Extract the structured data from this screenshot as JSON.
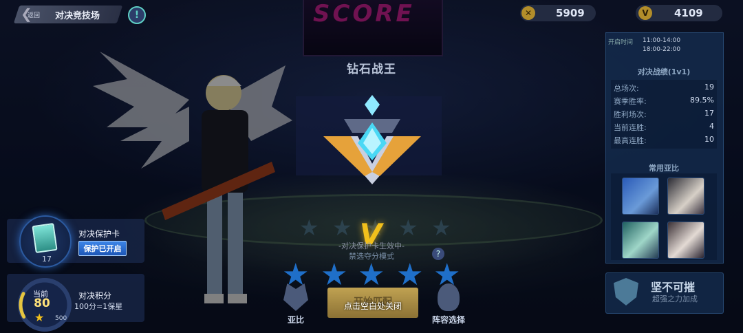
{
  "header": {
    "back_label": "返回",
    "title": "对决竞技场",
    "info": "!",
    "currency_gold": "5909",
    "currency_v": "4109"
  },
  "arena": {
    "scoreboard": "SCORE"
  },
  "rank": {
    "name": "钻石战王",
    "tier_letter": "V",
    "protect_status": "-对决保护卡生效中-",
    "mode": "禁选夺分模式",
    "help": "?",
    "stars_filled": 5,
    "stars_total": 5
  },
  "protect_card": {
    "count": "17",
    "title": "对决保护卡",
    "button": "保护已开启"
  },
  "points": {
    "now_label": "当前",
    "value": "80",
    "max": "500",
    "progress": 0.16,
    "title": "对决积分",
    "rule": "100分=1保星"
  },
  "bottom": {
    "yabi": "亚比",
    "match": "开始匹配",
    "close_hint": "点击空白处关闭",
    "team": "阵容选择"
  },
  "panel": {
    "open_label": "开启时间",
    "open_times": [
      "11:00-14:00",
      "18:00-22:00"
    ],
    "record_title": "对决战绩(1v1)",
    "stats": [
      {
        "label": "总场次:",
        "value": "19"
      },
      {
        "label": "赛季胜率:",
        "value": "89.5%"
      },
      {
        "label": "胜利场次:",
        "value": "17"
      },
      {
        "label": "当前连胜:",
        "value": "4"
      },
      {
        "label": "最高连胜:",
        "value": "10"
      }
    ],
    "common_title": "常用亚比",
    "strong": {
      "title": "坚不可摧",
      "sub": "超强之力加成"
    }
  },
  "colors": {
    "gold": "#f2c01c",
    "star_blue": "#1f6fc9",
    "panel": "#142d50"
  }
}
